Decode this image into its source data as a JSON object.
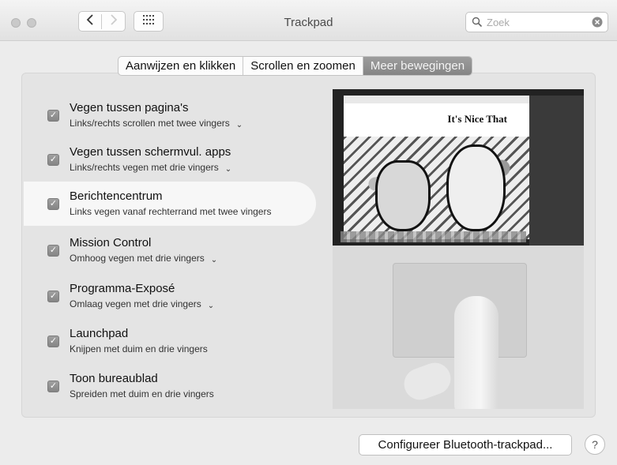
{
  "window": {
    "title": "Trackpad",
    "search_placeholder": "Zoek"
  },
  "icons": {
    "back": "chevron-left-icon",
    "forward": "chevron-right-icon",
    "grid": "grid-icon",
    "search": "magnifier-icon",
    "clear": "clear-icon"
  },
  "tabs": [
    {
      "label": "Aanwijzen en klikken",
      "active": false
    },
    {
      "label": "Scrollen en zoomen",
      "active": false
    },
    {
      "label": "Meer bewegingen",
      "active": true
    }
  ],
  "gestures": [
    {
      "title": "Vegen tussen pagina's",
      "subtitle": "Links/rechts scrollen met twee vingers",
      "checked": true,
      "has_menu": true
    },
    {
      "title": "Vegen tussen schermvul. apps",
      "subtitle": "Links/rechts vegen met drie vingers",
      "checked": true,
      "has_menu": true
    },
    {
      "title": "Berichtencentrum",
      "subtitle": "Links vegen vanaf rechterrand met twee vingers",
      "checked": true,
      "has_menu": false,
      "selected": true
    },
    {
      "title": "Mission Control",
      "subtitle": "Omhoog vegen met drie vingers",
      "checked": true,
      "has_menu": true
    },
    {
      "title": "Programma-Exposé",
      "subtitle": "Omlaag vegen met drie vingers",
      "checked": true,
      "has_menu": true
    },
    {
      "title": "Launchpad",
      "subtitle": "Knijpen met duim en drie vingers",
      "checked": true,
      "has_menu": false
    },
    {
      "title": "Toon bureaublad",
      "subtitle": "Spreiden met duim en drie vingers",
      "checked": true,
      "has_menu": false
    }
  ],
  "preview": {
    "brand": "It's Nice That"
  },
  "footer": {
    "configure_button": "Configureer Bluetooth-trackpad...",
    "help_button": "?"
  }
}
